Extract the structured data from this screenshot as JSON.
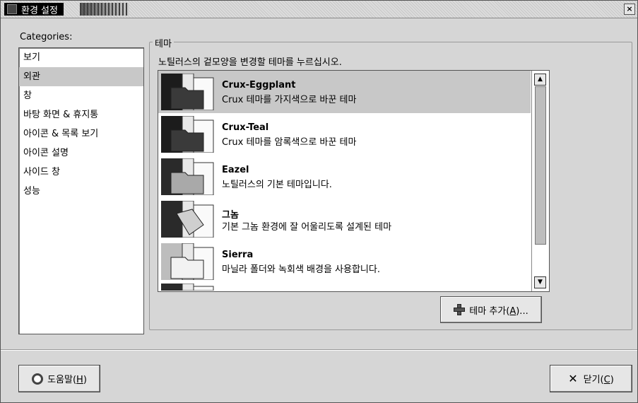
{
  "window": {
    "title": "환경 설정",
    "close_symbol": "×"
  },
  "categories": {
    "label": "Categories:",
    "items": [
      "보기",
      "외관",
      "창",
      "바탕 화면 & 휴지통",
      "아이콘 & 목록 보기",
      "아이콘 설명",
      "사이드 창",
      "성능"
    ],
    "selected_index": 1
  },
  "theme_frame": {
    "label": "테마",
    "description": "노틸러스의 겉모양을 변경할 테마를 누르십시오."
  },
  "themes": [
    {
      "name": "Crux-Eggplant",
      "description": "Crux 테마를 가지색으로 바꾼 테마",
      "selected": true,
      "icon": "folder-dark-icon"
    },
    {
      "name": "Crux-Teal",
      "description": "Crux 테마를 암록색으로 바꾼 테마",
      "selected": false,
      "icon": "folder-dark-icon"
    },
    {
      "name": "Eazel",
      "description": "노틸러스의 기본 테마입니다.",
      "selected": false,
      "icon": "folder-gray-icon"
    },
    {
      "name": "그놈",
      "description": "기본 그놈 환경에 잘 어울리도록 설계된 테마",
      "selected": false,
      "icon": "folder-open-icon"
    },
    {
      "name": "Sierra",
      "description": "마닐라 폴더와 녹회색 배경을 사용합니다.",
      "selected": false,
      "icon": "folder-light-icon"
    }
  ],
  "scrollbar": {
    "up_symbol": "▲",
    "down_symbol": "▼"
  },
  "add_theme_button": {
    "label_main": "테마 추가(",
    "mnemonic": "A",
    "label_end": ")..."
  },
  "help_button": {
    "label_main": "도움말(",
    "mnemonic": "H",
    "label_end": ")"
  },
  "close_button": {
    "icon_symbol": "✕",
    "label_main": "닫기(",
    "mnemonic": "C",
    "label_end": ")"
  }
}
